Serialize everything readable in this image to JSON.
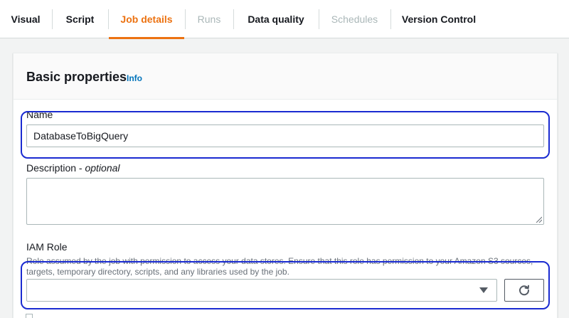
{
  "tabs": [
    {
      "label": "Visual",
      "state": "normal"
    },
    {
      "label": "Script",
      "state": "normal"
    },
    {
      "label": "Job details",
      "state": "active"
    },
    {
      "label": "Runs",
      "state": "disabled"
    },
    {
      "label": "Data quality",
      "state": "normal"
    },
    {
      "label": "Schedules",
      "state": "disabled"
    },
    {
      "label": "Version Control",
      "state": "normal"
    }
  ],
  "colors": {
    "accent": "#ec7211",
    "link": "#0073bb",
    "highlight": "#1a2bd1",
    "disabled": "#aab7b8"
  },
  "panel": {
    "title": "Basic properties",
    "info_link": "Info"
  },
  "fields": {
    "name": {
      "label": "Name",
      "value": "DatabaseToBigQuery"
    },
    "description": {
      "label": "Description - ",
      "optional": "optional",
      "value": ""
    },
    "iam_role": {
      "label": "IAM Role",
      "help_line1": "Role assumed by the job with permission to access your data stores. Ensure that this role has permission to your Amazon S3 sources,",
      "help_line2": "targets, temporary directory, scripts, and any libraries used by the job.",
      "selected": "",
      "refresh_icon": "refresh-icon",
      "caret_icon": "caret-down-icon"
    }
  }
}
